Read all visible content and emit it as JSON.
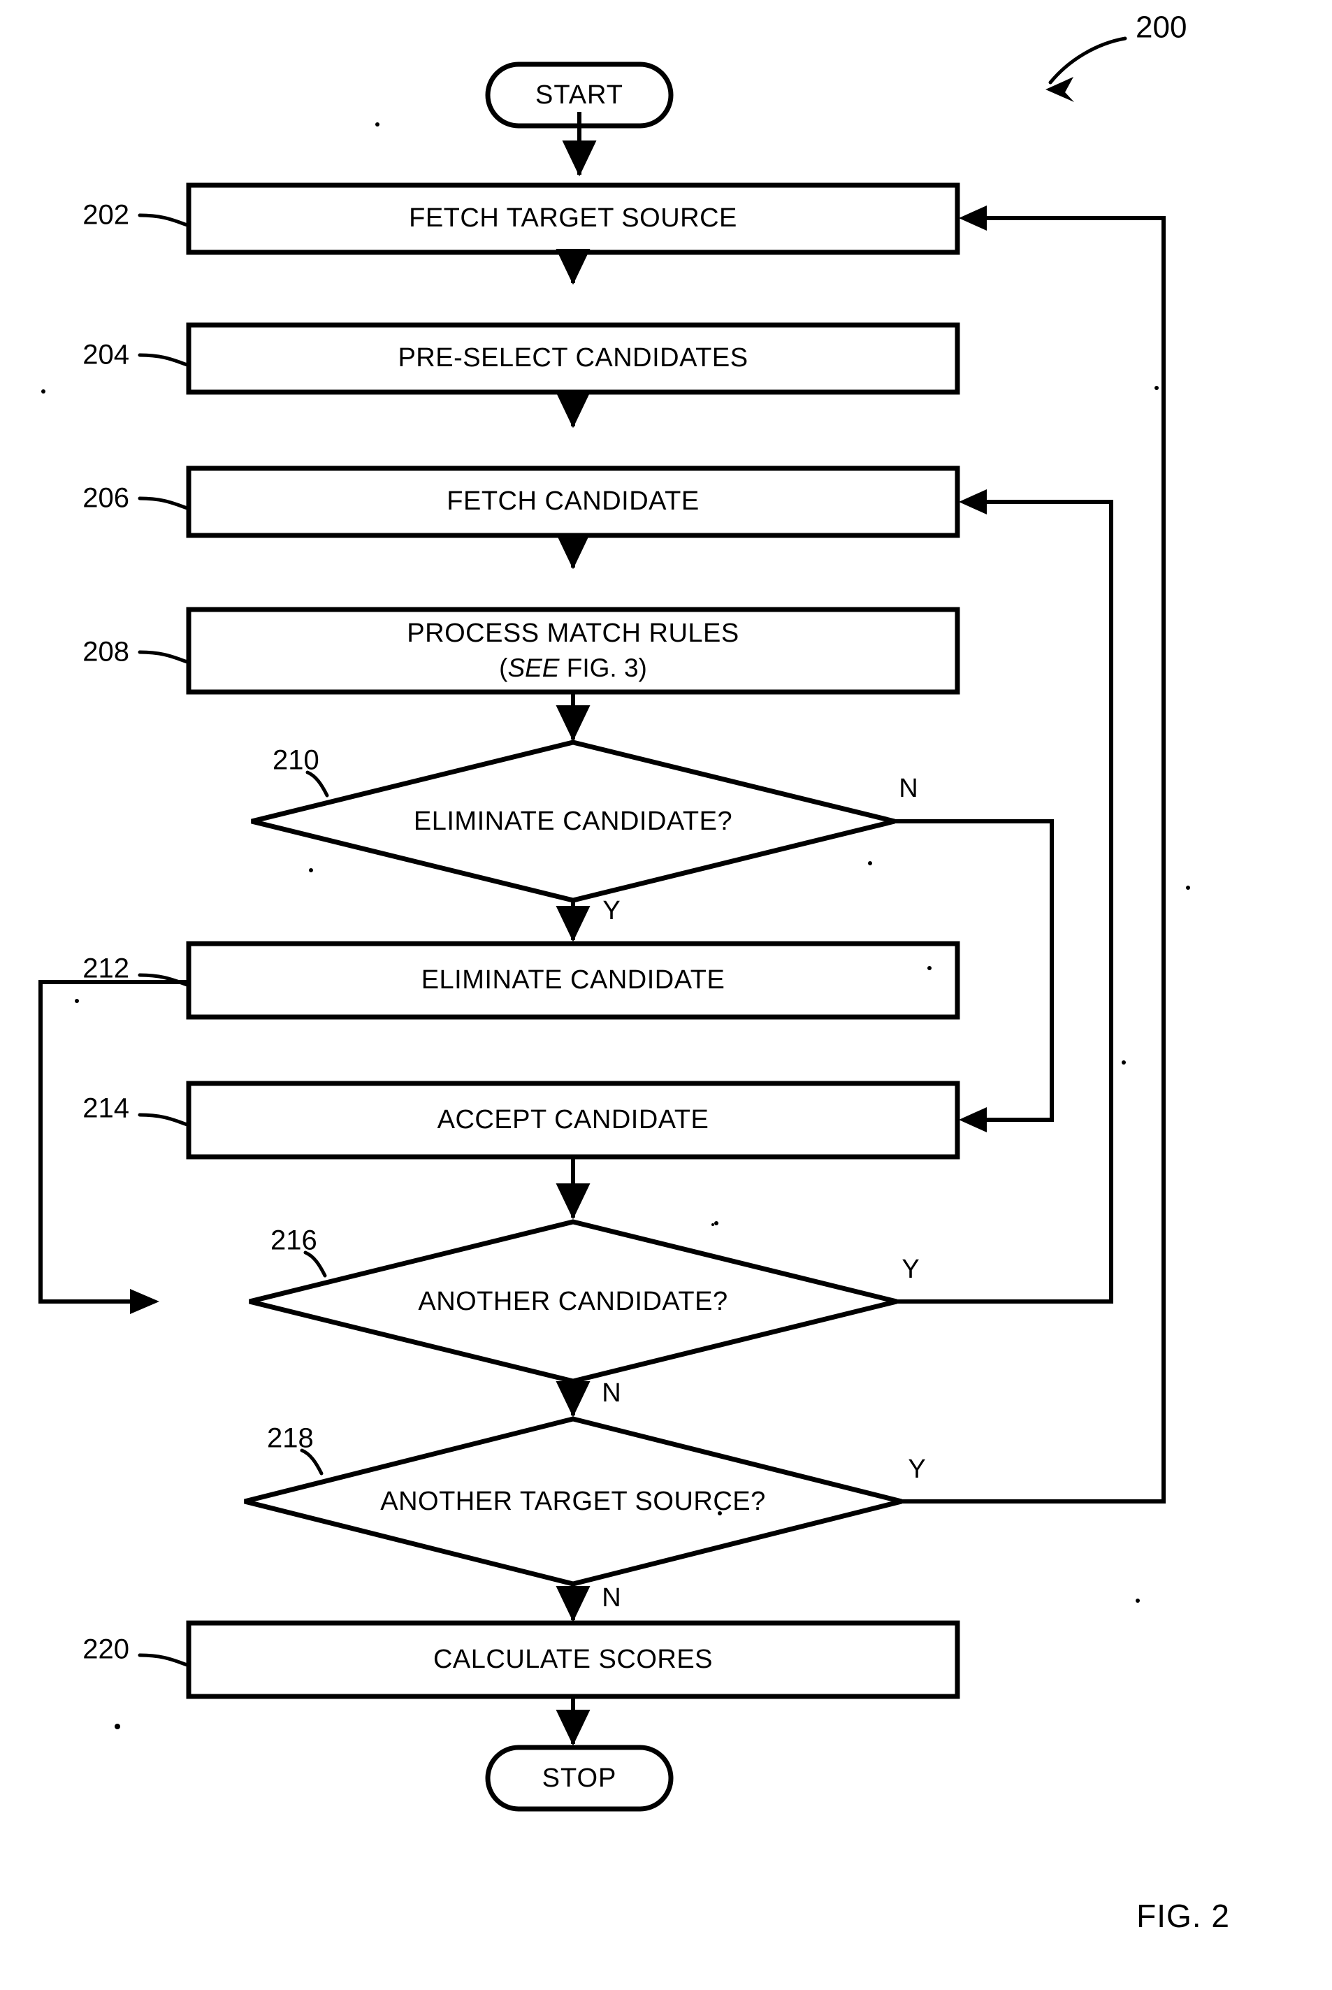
{
  "figure": {
    "caption": "FIG. 2",
    "reference_numeral": "200",
    "background_color": "#ffffff",
    "line_color": "#000000"
  },
  "chart_data": {
    "type": "diagram",
    "subtype": "flowchart",
    "title": "FIG. 2",
    "diagram_reference": "200",
    "nodes": [
      {
        "id": "start",
        "ref": "",
        "shape": "terminator",
        "text": "START"
      },
      {
        "id": "n202",
        "ref": "202",
        "shape": "process",
        "text": "FETCH TARGET SOURCE"
      },
      {
        "id": "n204",
        "ref": "204",
        "shape": "process",
        "text": "PRE-SELECT CANDIDATES"
      },
      {
        "id": "n206",
        "ref": "206",
        "shape": "process",
        "text": "FETCH CANDIDATE"
      },
      {
        "id": "n208",
        "ref": "208",
        "shape": "process",
        "text": "PROCESS MATCH RULES",
        "text_line2_prefix": "(",
        "text_line2_italic": "SEE",
        "text_line2_suffix": " FIG. 3)"
      },
      {
        "id": "n210",
        "ref": "210",
        "shape": "decision",
        "text": "ELIMINATE CANDIDATE?"
      },
      {
        "id": "n212",
        "ref": "212",
        "shape": "process",
        "text": "ELIMINATE CANDIDATE"
      },
      {
        "id": "n214",
        "ref": "214",
        "shape": "process",
        "text": "ACCEPT CANDIDATE"
      },
      {
        "id": "n216",
        "ref": "216",
        "shape": "decision",
        "text": "ANOTHER CANDIDATE?"
      },
      {
        "id": "n218",
        "ref": "218",
        "shape": "decision",
        "text": "ANOTHER TARGET SOURCE?"
      },
      {
        "id": "n220",
        "ref": "220",
        "shape": "process",
        "text": "CALCULATE SCORES"
      },
      {
        "id": "stop",
        "ref": "",
        "shape": "terminator",
        "text": "STOP"
      }
    ],
    "edges": [
      {
        "from": "start",
        "to": "n202",
        "label": ""
      },
      {
        "from": "n202",
        "to": "n204",
        "label": ""
      },
      {
        "from": "n204",
        "to": "n206",
        "label": ""
      },
      {
        "from": "n206",
        "to": "n208",
        "label": ""
      },
      {
        "from": "n208",
        "to": "n210",
        "label": ""
      },
      {
        "from": "n210",
        "to": "n212",
        "label": "Y"
      },
      {
        "from": "n210",
        "to": "n214",
        "label": "N"
      },
      {
        "from": "n212",
        "to": "n216",
        "label": ""
      },
      {
        "from": "n214",
        "to": "n216",
        "label": ""
      },
      {
        "from": "n216",
        "to": "n206",
        "label": "Y"
      },
      {
        "from": "n216",
        "to": "n218",
        "label": "N"
      },
      {
        "from": "n218",
        "to": "n202",
        "label": "Y"
      },
      {
        "from": "n218",
        "to": "n220",
        "label": "N"
      },
      {
        "from": "n220",
        "to": "stop",
        "label": ""
      }
    ]
  },
  "nodes": {
    "start": {
      "label": "START"
    },
    "n202": {
      "label": "FETCH TARGET SOURCE",
      "ref": "202"
    },
    "n204": {
      "label": "PRE-SELECT CANDIDATES",
      "ref": "204"
    },
    "n206": {
      "label": "FETCH CANDIDATE",
      "ref": "206"
    },
    "n208": {
      "label": "PROCESS MATCH RULES",
      "ref": "208",
      "sub_open": "(",
      "sub_italic": "SEE",
      "sub_rest": " FIG. 3)"
    },
    "n210": {
      "label": "ELIMINATE CANDIDATE?",
      "ref": "210"
    },
    "n212": {
      "label": "ELIMINATE CANDIDATE",
      "ref": "212"
    },
    "n214": {
      "label": "ACCEPT CANDIDATE",
      "ref": "214"
    },
    "n216": {
      "label": "ANOTHER CANDIDATE?",
      "ref": "216"
    },
    "n218": {
      "label": "ANOTHER TARGET SOURCE?",
      "ref": "218"
    },
    "n220": {
      "label": "CALCULATE SCORES",
      "ref": "220"
    },
    "stop": {
      "label": "STOP"
    }
  },
  "branch_labels": {
    "n210_n": "N",
    "n210_y": "Y",
    "n216_y": "Y",
    "n216_n": "N",
    "n218_y": "Y",
    "n218_n": "N"
  }
}
